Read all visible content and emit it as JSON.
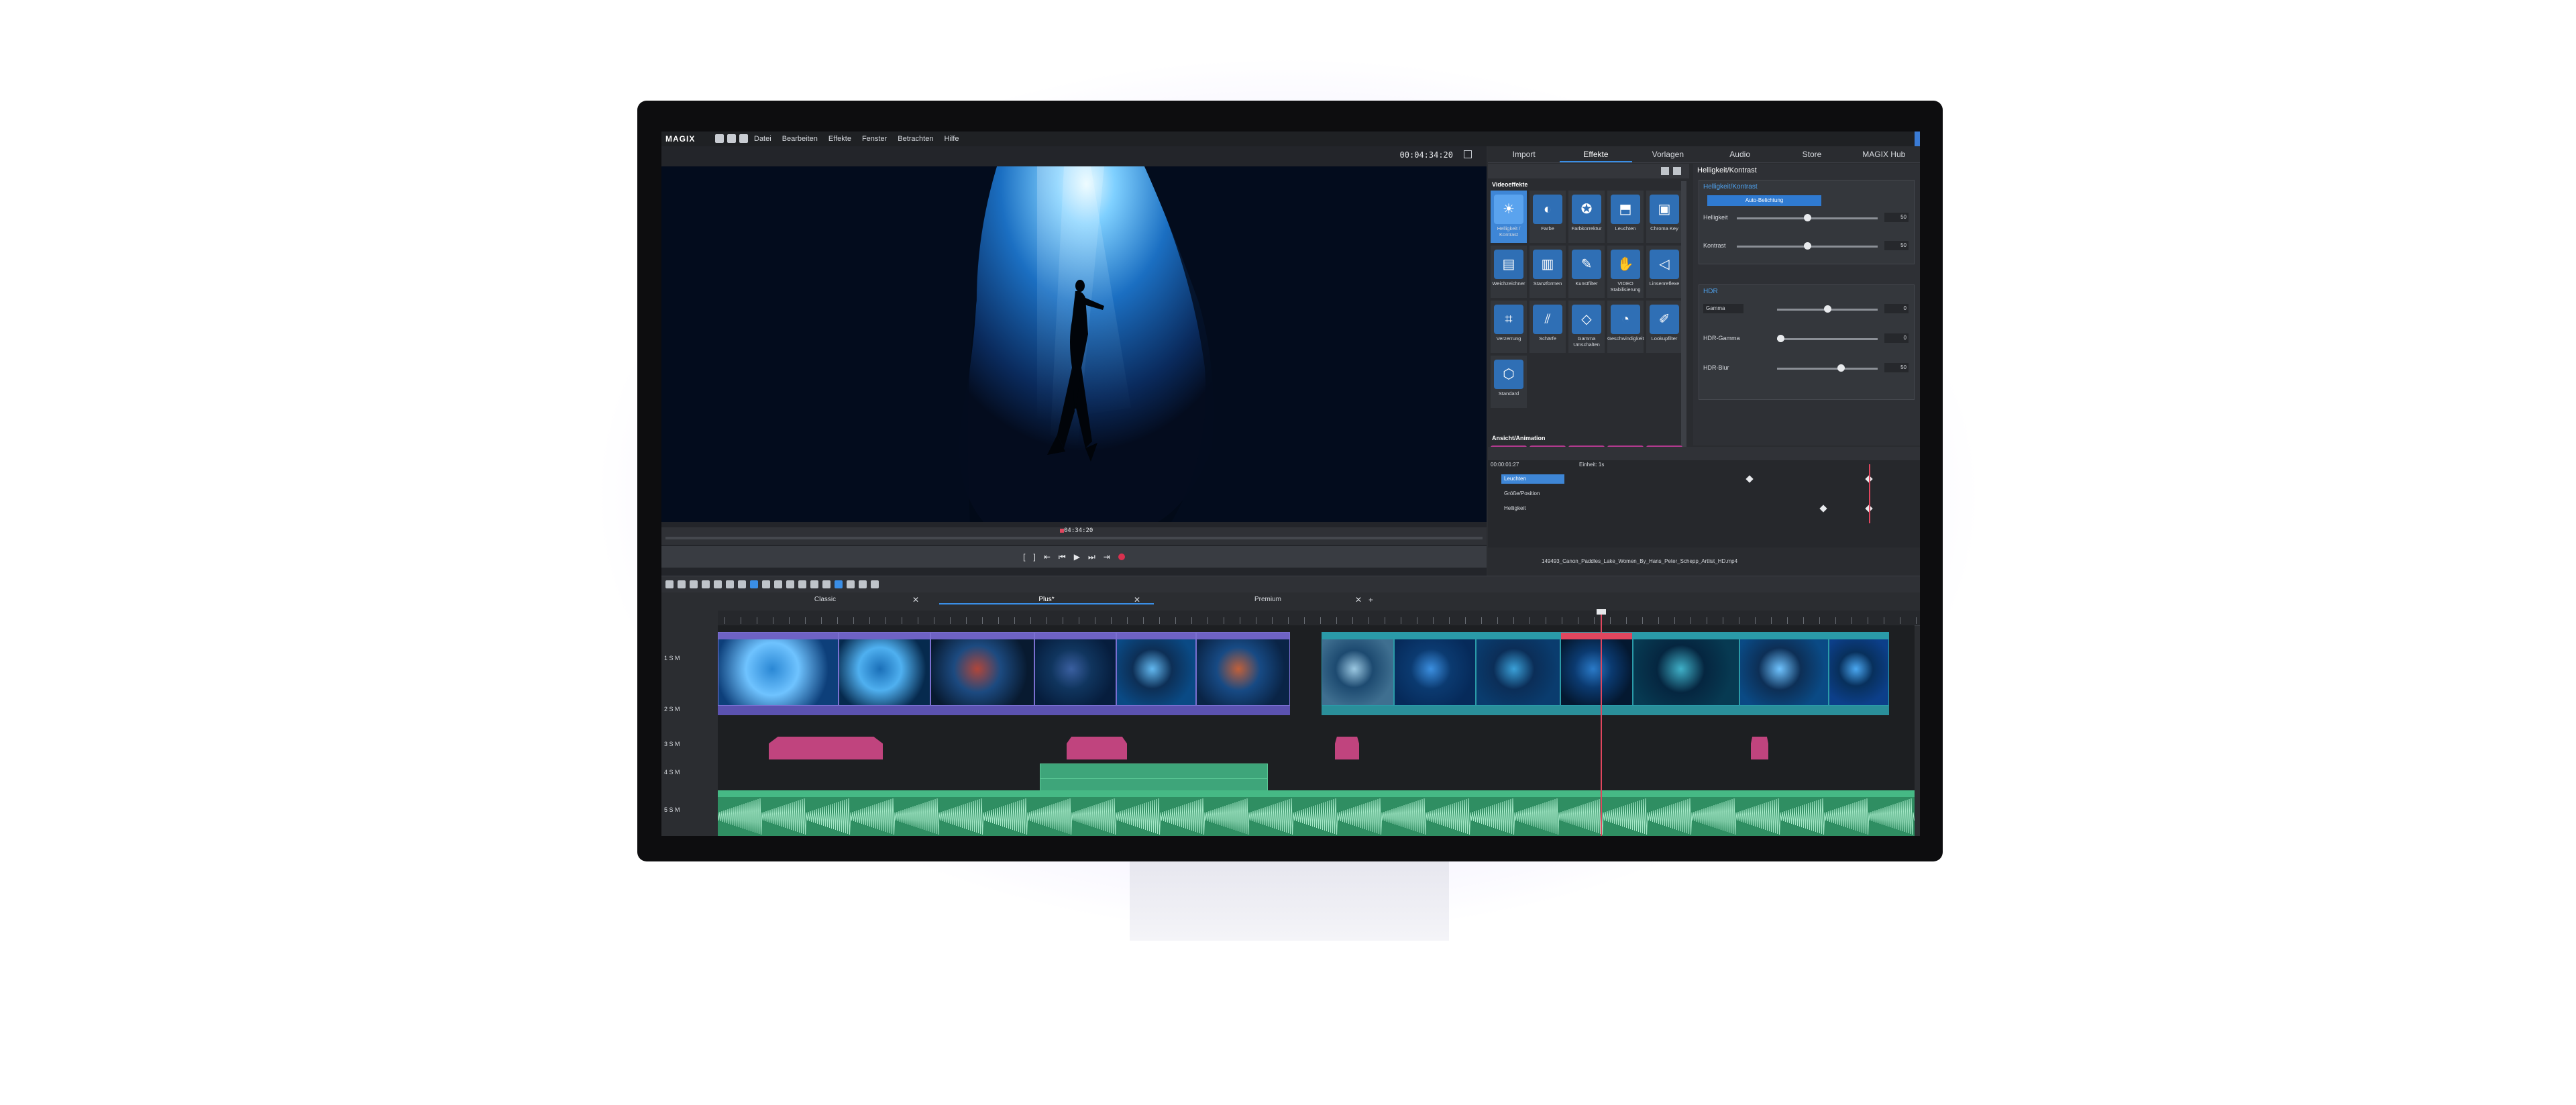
{
  "app": {
    "logo": "MAGIX",
    "menu": [
      "Datei",
      "Bearbeiten",
      "Effekte",
      "Fenster",
      "Betrachten",
      "Hilfe"
    ]
  },
  "preview": {
    "timecode": "00:04:34:20",
    "scrub_timecode": "04:34:20"
  },
  "rpanel": {
    "tabs": [
      "Import",
      "Effekte",
      "Vorlagen",
      "Audio",
      "Store",
      "MAGIX Hub"
    ],
    "active_tab": "Effekte",
    "section_video": "Videoeffekte",
    "effects": [
      {
        "label": "Helligkeit / Kontrast",
        "icon": "☀",
        "selected": true
      },
      {
        "label": "Farbe",
        "icon": "◐"
      },
      {
        "label": "Farbkorrektur",
        "icon": "✪"
      },
      {
        "label": "Leuchten",
        "icon": "⬒"
      },
      {
        "label": "Chroma Key",
        "icon": "▣"
      },
      {
        "label": "Weichzeichner",
        "icon": "▤"
      },
      {
        "label": "Stanzformen",
        "icon": "▥"
      },
      {
        "label": "Kunstfilter",
        "icon": "✎"
      },
      {
        "label": "VIDEO Stabilisierung",
        "icon": "✋"
      },
      {
        "label": "Linsenreflexe",
        "icon": "◁"
      },
      {
        "label": "Verzerrung",
        "icon": "⌗"
      },
      {
        "label": "Schärfe",
        "icon": "⫽"
      },
      {
        "label": "Gamma Umschalten",
        "icon": "◇"
      },
      {
        "label": "Geschwindigkeit",
        "icon": "◔"
      },
      {
        "label": "Lookupfilter",
        "icon": "✐"
      },
      {
        "label": "Standard",
        "icon": "⬡"
      }
    ],
    "section_anim": "Ansicht/Animation",
    "anim_icons": [
      "✣",
      "⌖",
      "↯",
      "⟳",
      "⤢"
    ],
    "props": {
      "title": "Helligkeit/Kontrast",
      "group1": "Helligkeit/Kontrast",
      "auto_button": "Auto-Belichtung",
      "helligkeit_label": "Helligkeit",
      "helligkeit_value": "50",
      "kontrast_label": "Kontrast",
      "kontrast_value": "50",
      "group2": "HDR",
      "gamma_select": "Gamma",
      "gamma_value": "0",
      "hdr_gamma_label": "HDR-Gamma",
      "hdr_gamma_value": "0",
      "hdr_blur_label": "HDR-Blur",
      "hdr_blur_value": "50"
    }
  },
  "keyframes": {
    "time": "00:00:01:27",
    "unit": "Einheit: 1s",
    "rows": [
      "Leuchten",
      "Größe/Position",
      "Helligkeit"
    ],
    "file": "149493_Canon_Paddles_Lake_Women_By_Hans_Peter_Schepp_Artlist_HD.mp4"
  },
  "timeline": {
    "tabs": [
      "Classic",
      "Plus*",
      "Premium"
    ],
    "active_tab": "Plus*",
    "track_labels": [
      "1 S M",
      "2 S M",
      "3 S M",
      "4 S M",
      "5 S M"
    ]
  }
}
